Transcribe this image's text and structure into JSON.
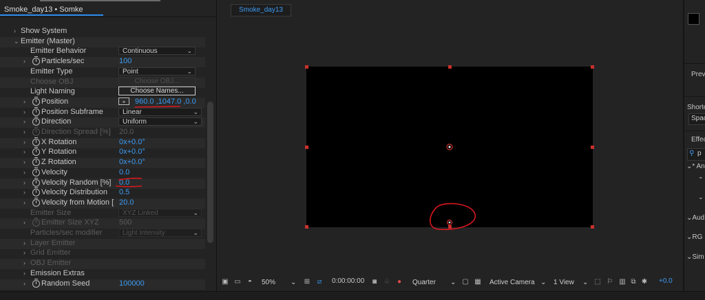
{
  "effect_controls": {
    "tab_title": "Smoke_day13 • Somke",
    "properties": [
      {
        "label": "Show System",
        "indent": 1,
        "arrow": "›",
        "clock": false
      },
      {
        "label": "Emitter (Master)",
        "indent": 1,
        "arrow": "⌄",
        "clock": false
      },
      {
        "label": "Emitter Behavior",
        "indent": 2,
        "dropdown": "Continuous"
      },
      {
        "label": "Particles/sec",
        "indent": 2,
        "arrow": "›",
        "clock": true,
        "value": "100"
      },
      {
        "label": "Emitter Type",
        "indent": 2,
        "dropdown": "Point"
      },
      {
        "label": "Choose OBJ",
        "indent": 2,
        "disabled": true,
        "button": "Choose OBJ..."
      },
      {
        "label": "Light Naming",
        "indent": 2,
        "button": "Choose Names..."
      },
      {
        "label": "Position",
        "indent": 2,
        "arrow": "›",
        "clock": true,
        "value": "960.0 ,1047.0 ,0.0"
      },
      {
        "label": "Position Subframe",
        "indent": 2,
        "arrow": "›",
        "clock": true,
        "dropdown": "Linear"
      },
      {
        "label": "Direction",
        "indent": 2,
        "arrow": "›",
        "clock": true,
        "dropdown": "Uniform"
      },
      {
        "label": "Direction Spread [%]",
        "indent": 2,
        "arrow": "›",
        "clock": true,
        "value": "20.0",
        "disabled": true
      },
      {
        "label": "X Rotation",
        "indent": 2,
        "arrow": "›",
        "clock": true,
        "value": "0x+0.0°"
      },
      {
        "label": "Y Rotation",
        "indent": 2,
        "arrow": "›",
        "clock": true,
        "value": "0x+0.0°"
      },
      {
        "label": "Z Rotation",
        "indent": 2,
        "arrow": "›",
        "clock": true,
        "value": "0x+0.0°"
      },
      {
        "label": "Velocity",
        "indent": 2,
        "arrow": "›",
        "clock": true,
        "value": "0.0"
      },
      {
        "label": "Velocity Random [%]",
        "indent": 2,
        "arrow": "›",
        "clock": true,
        "value": "0.0"
      },
      {
        "label": "Velocity Distribution",
        "indent": 2,
        "arrow": "›",
        "clock": true,
        "value": "0.5"
      },
      {
        "label": "Velocity from Motion [",
        "indent": 2,
        "arrow": "›",
        "clock": true,
        "value": "20.0"
      },
      {
        "label": "Emitter Size",
        "indent": 2,
        "disabled": true,
        "dropdown": "XYZ Linked"
      },
      {
        "label": "Emitter Size XYZ",
        "indent": 2,
        "arrow": "›",
        "clock": true,
        "value": "500",
        "disabled": true
      },
      {
        "label": "Particles/sec modifier",
        "indent": 2,
        "disabled": true,
        "dropdown": "Light Intensity"
      },
      {
        "label": "Layer Emitter",
        "indent": 2,
        "arrow": "›",
        "disabled": true
      },
      {
        "label": "Grid Emitter",
        "indent": 2,
        "arrow": "›",
        "disabled": true
      },
      {
        "label": "OBJ Emitter",
        "indent": 2,
        "arrow": "›",
        "disabled": true
      },
      {
        "label": "Emission Extras",
        "indent": 2,
        "arrow": "›"
      },
      {
        "label": "Random Seed",
        "indent": 2,
        "arrow": "›",
        "clock": true,
        "value": "100000"
      }
    ]
  },
  "viewer": {
    "comp_tab": "Smoke_day13",
    "zoom": "50%",
    "timecode": "0:00:00:00",
    "resolution": "Quarter",
    "camera": "Active Camera",
    "views": "1 View",
    "exposure": "+0.0"
  },
  "right_panel": {
    "preview_label": "Previ",
    "shortcut_label": "Shortc",
    "shortcut_value": "Spac",
    "effects_label": "Effec",
    "search_text": "p",
    "items": [
      "* An",
      "Aud",
      "RG",
      "Sim"
    ]
  },
  "colors": {
    "accent_blue": "#3d9cf5",
    "handle_red": "#c9302c",
    "annotation_red": "#d9171f"
  }
}
